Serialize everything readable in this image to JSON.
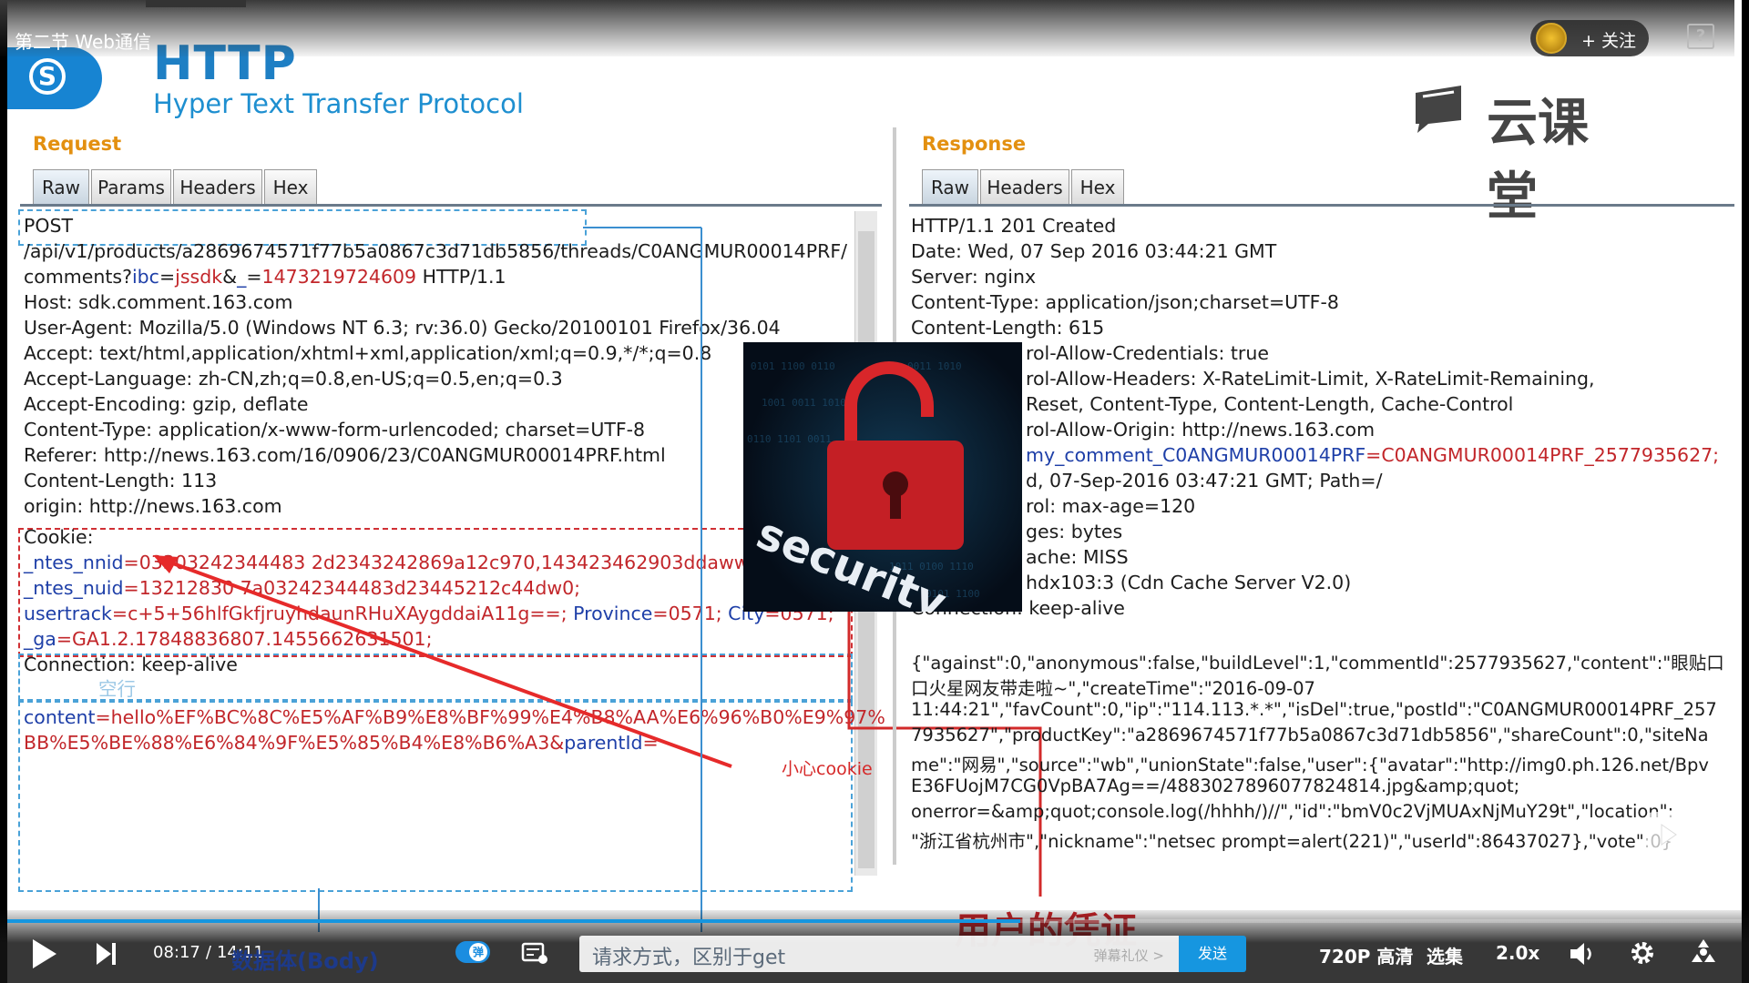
{
  "video": {
    "title": "第二节 Web通信",
    "follow_label": "+ 关注",
    "help_icon": "question-icon"
  },
  "slide": {
    "heading": "HTTP",
    "subheading": "Hyper Text Transfer Protocol",
    "watermark": "云课堂",
    "request": {
      "label": "Request",
      "tabs": [
        "Raw",
        "Params",
        "Headers",
        "Hex"
      ],
      "lines": {
        "l1": "POST",
        "l2": "/api/v1/products/a2869674571f77b5a0867c3d71db5856/threads/C0ANGMUR00014PRF/",
        "l3a": "comments?",
        "l3b": "ibc",
        "l3c": "=",
        "l3d": "jssdk",
        "l3e": "&",
        "l3f": "_",
        "l3g": "=",
        "l3h": "1473219724609",
        "l3i": " HTTP/1.1",
        "l4": "Host: sdk.comment.163.com",
        "l5": "User-Agent: Mozilla/5.0 (Windows NT 6.3; rv:36.0) Gecko/20100101 Firefox/36.04",
        "l6": "Accept: text/html,application/xhtml+xml,application/xml;q=0.9,*/*;q=0.8",
        "l7": "Accept-Language: zh-CN,zh;q=0.8,en-US;q=0.5,en;q=0.3",
        "l8": "Accept-Encoding: gzip, deflate",
        "l9": "Content-Type: application/x-www-form-urlencoded; charset=UTF-8",
        "l10": "Referer: http://news.163.com/16/0906/23/C0ANGMUR00014PRF.html",
        "l11": "Content-Length: 113",
        "l12": "origin: http://news.163.com",
        "l13": "Cookie:",
        "l14a": "_ntes_nnid",
        "l14b": "=03303242344483 2d2343242869a12c970,143423462903ddaww906",
        "l15a": "_ntes_nuid",
        "l15b": "=13212830 7a03242344483d23445212c44dw0;",
        "l16a": "usertrack",
        "l16b": "=c+5+56hlfGkfjruyhdaunRHuXAygddaiA11g==;",
        "l16c": " Province",
        "l16d": "=0571;",
        "l16e": " City",
        "l16f": "=0571;",
        "l17a": "_ga",
        "l17b": "=GA1.2.17848836807.1455662631501;",
        "l18": "Connection: keep-alive",
        "l19": "空行",
        "l20a": "content",
        "l20b": "=hello%EF%BC%8C%E5%AF%B9%E8%BF%99%E4%B8%AA%E6%96%B0%E9%97%",
        "l21a": "BB%E5%BE%88%E6%84%9F%E5%85%B4%E8%B6%A3",
        "l21b": "&",
        "l21c": "parentId",
        "l21d": "="
      }
    },
    "response": {
      "label": "Response",
      "tabs": [
        "Raw",
        "Headers",
        "Hex"
      ],
      "lines": {
        "r1": "HTTP/1.1 201 Created",
        "r2": "Date: Wed, 07 Sep 2016 03:44:21 GMT",
        "r3": "Server: nginx",
        "r4": "Content-Type: application/json;charset=UTF-8",
        "r5": "Content-Length: 615",
        "r6": "rol-Allow-Credentials: true",
        "r7a": "rol-Allow-Headers: ",
        "r7b": "X-RateLimit-Limit, X-RateLimit-Remaining,",
        "r8": "Reset, Content-Type, Content-Length, Cache-Control",
        "r9": "rol-Allow-Origin: http://news.163.com",
        "r10a": "my_comment_C0ANGMUR00014PRF",
        "r10b": "=C0ANGMUR00014PRF_2577935627;",
        "r11": "d, 07-Sep-2016 03:47:21 GMT; Path=/",
        "r12": "rol: max-age=120",
        "r13": "ges: bytes",
        "r14": "ache: MISS",
        "r15": "hdx103:3 (Cdn Cache Server V2.0)",
        "r16": "Connection: keep-alive",
        "r17": "{\"against\":0,\"anonymous\":false,\"buildLevel\":1,\"commentId\":2577935627,\"content\":\"眼贴口",
        "r18": "口火星网友带走啦~\",\"createTime\":\"2016-09-07",
        "r19": "11:44:21\",\"favCount\":0,\"ip\":\"114.113.*.*\",\"isDel\":true,\"postId\":\"C0ANGMUR00014PRF_257",
        "r20": "7935627\",\"productKey\":\"a2869674571f77b5a0867c3d71db5856\",\"shareCount\":0,\"siteNa",
        "r21": "me\":\"网易\",\"source\":\"wb\",\"unionState\":false,\"user\":{\"avatar\":\"http://img0.ph.126.net/Bpv",
        "r22": "E36FUojM7CG0VpBA7Ag==/4883027896077824814.jpg&amp;quot;",
        "r23": "onerror=&amp;quot;console.log(/hhhh/)//\",\"id\":\"bmV0c2VjMUAxNjMuY29t\",\"location\":",
        "r24": "\"浙江省杭州市\",\"nickname\":\"netsec prompt=alert(221)\",\"userId\":86437027},\"vote\":0}"
      }
    },
    "security_image_text": "security",
    "annotations": {
      "cookie_note": "小心cookie",
      "user_credential": "用户的凭证",
      "body_label": "数据体(Body)",
      "request_method_note": "请求方式，区别于get"
    }
  },
  "player": {
    "time_current": "08:17",
    "time_sep": "/",
    "time_total": "14:11",
    "progress_fraction": 0.584,
    "barrage_toggle_label": "弹",
    "danmu_etiquette": "弹幕礼仪 >",
    "send_label": "发送",
    "quality_label": "720P 高清",
    "episodes_label": "选集",
    "speed_label": "2.0x",
    "accent_color": "#1696e0"
  }
}
